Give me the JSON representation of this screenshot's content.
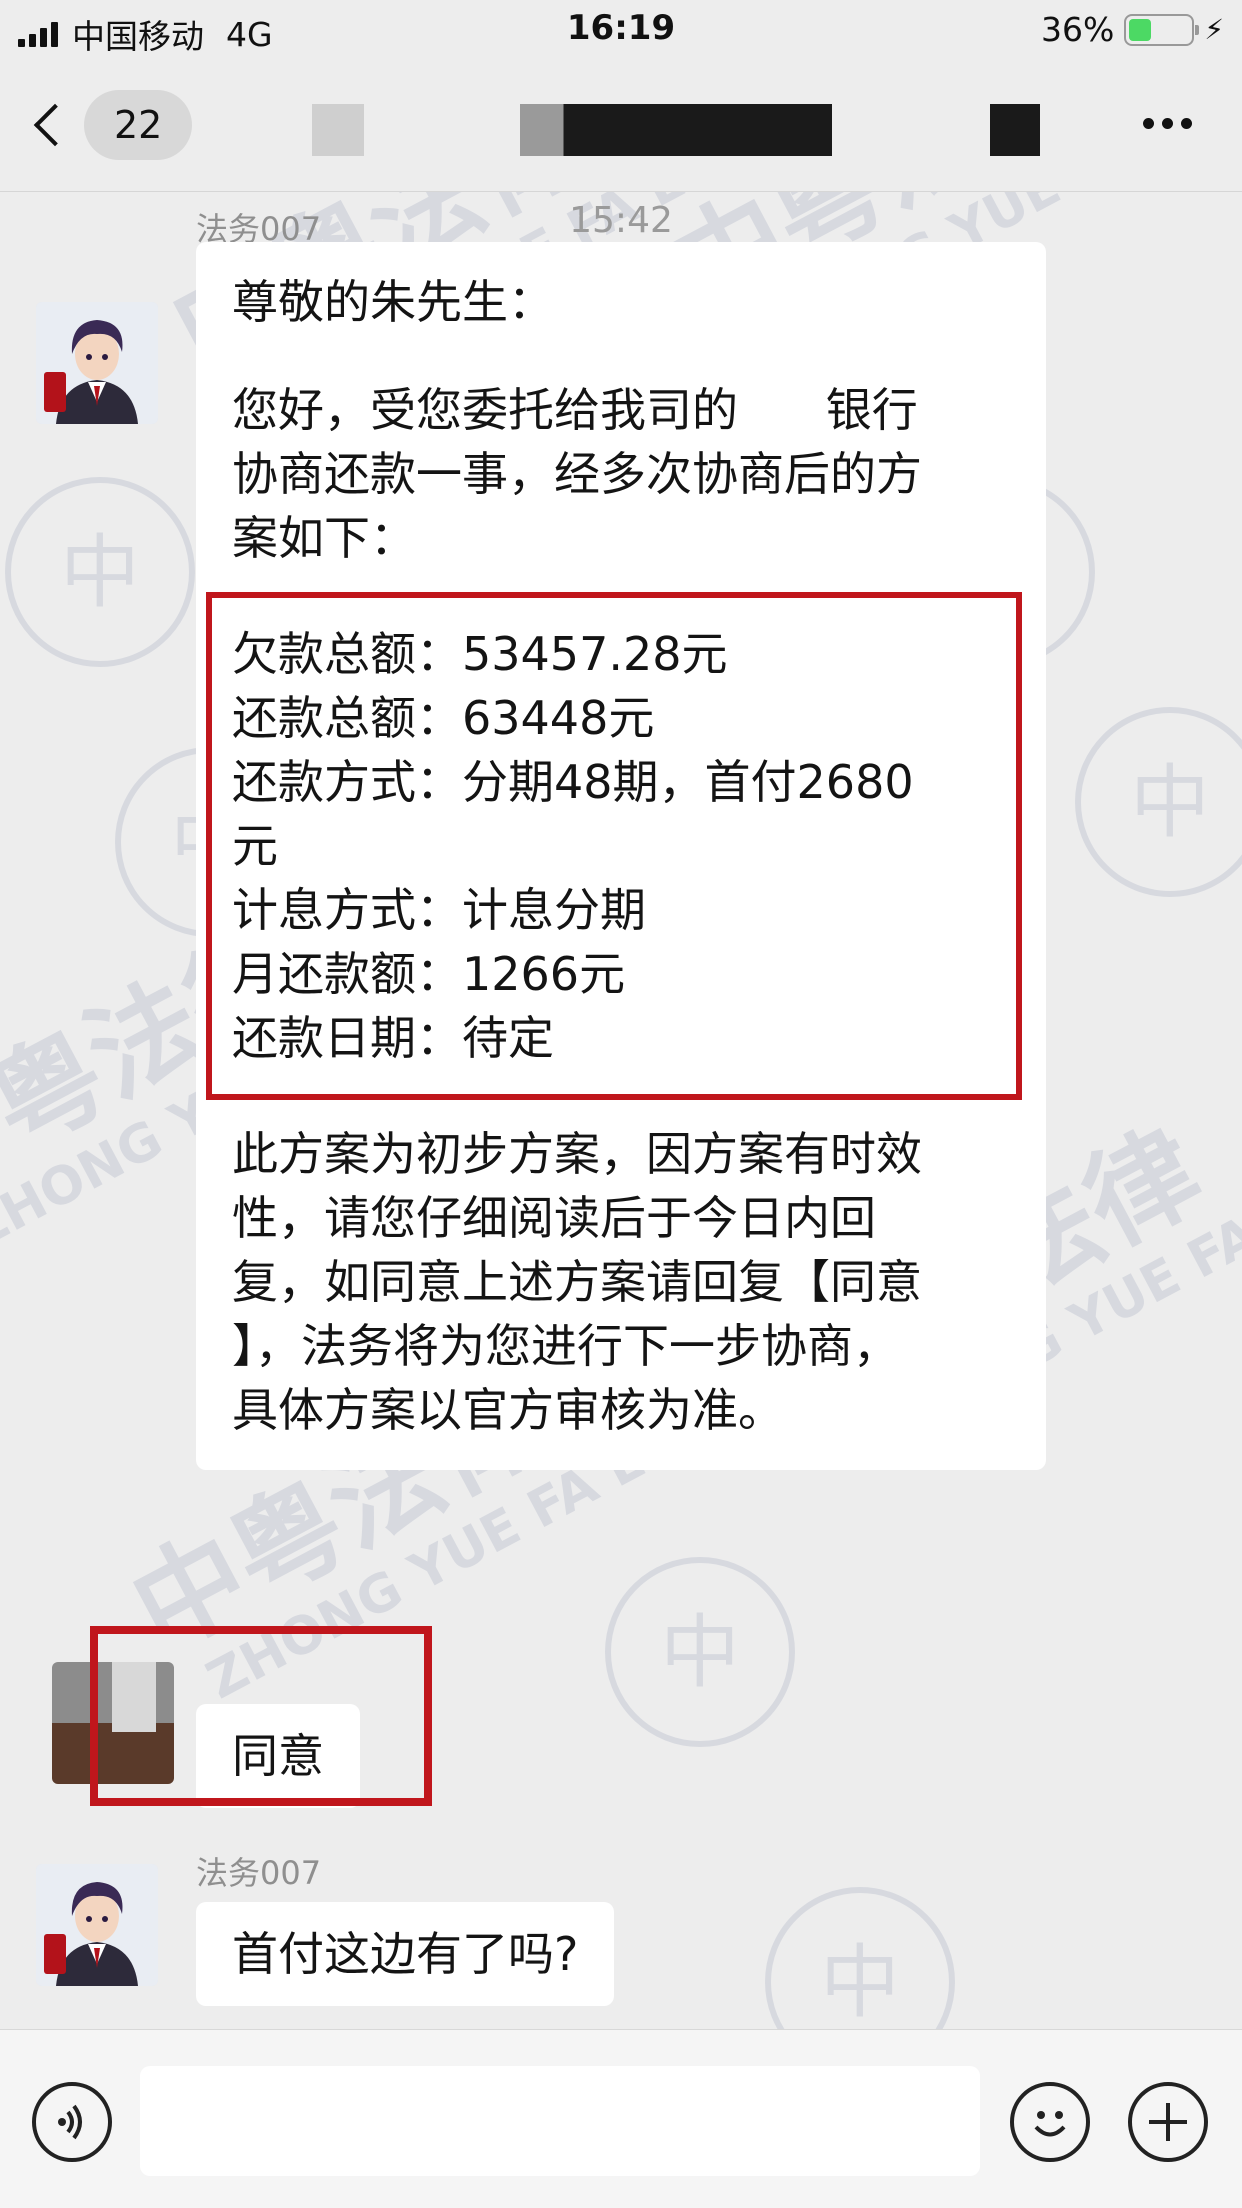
{
  "status_bar": {
    "carrier": "中国移动",
    "network": "4G",
    "time": "16:19",
    "battery": "36%",
    "battery_level": 0.36
  },
  "nav": {
    "unread_count": "22"
  },
  "chat": {
    "timestamp": "15:42",
    "messages": [
      {
        "sender": "法务007",
        "greeting": "尊敬的朱先生：",
        "intro": "您好，受您委托给我司的      银行\n协商还款一事，经多次协商后的方\n案如下：",
        "plan": [
          "欠款总额：53457.28元",
          "还款总额：63448元",
          "还款方式：分期48期，首付2680",
          "元",
          "计息方式：计息分期",
          "月还款额：1266元",
          "还款日期：待定"
        ],
        "outro": "此方案为初步方案，因方案有时效\n性，请您仔细阅读后于今日内回\n复，如同意上述方案请回复【同意\n】，法务将为您进行下一步协商，\n具体方案以官方审核为准。"
      },
      {
        "sender": "",
        "text": "同意"
      },
      {
        "sender": "法务007",
        "text": "首付这边有了吗?"
      }
    ]
  },
  "watermark": {
    "chinese": "中粤法律",
    "latin": "ZHONG YUE FA LV",
    "seal_char": "中"
  },
  "colors": {
    "highlight": "#c0161c",
    "background": "#ededed",
    "bubble": "#ffffff"
  }
}
